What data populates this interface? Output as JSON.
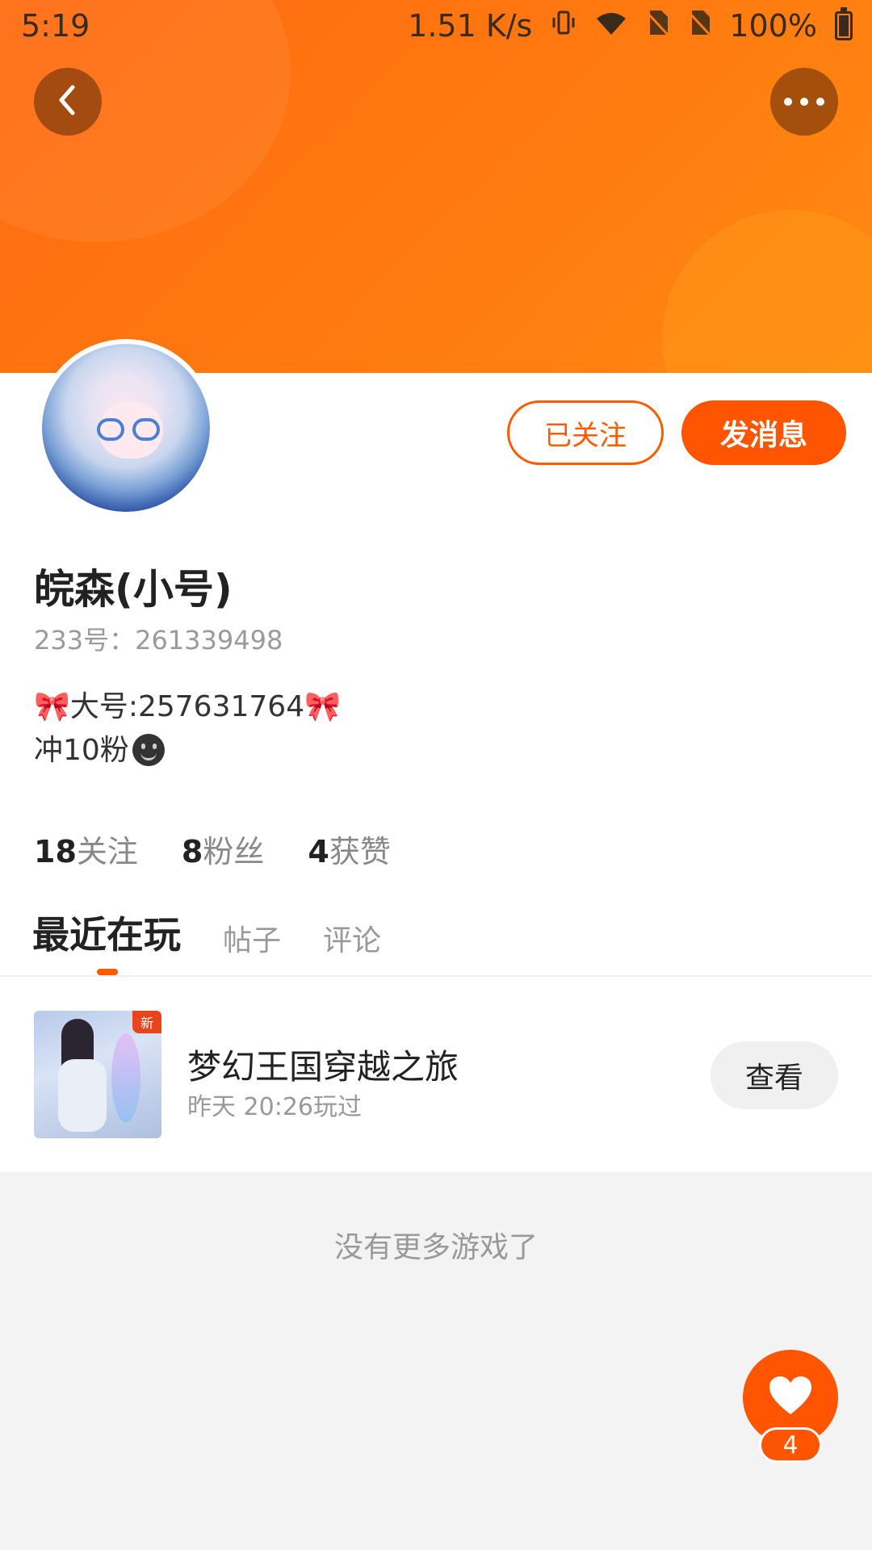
{
  "status_bar": {
    "time": "5:19",
    "net_speed": "1.51 K/s",
    "battery": "100%"
  },
  "header": {
    "back_icon": "chevron-left-icon",
    "more_icon": "more-dots-icon"
  },
  "profile": {
    "name": "皖森(小号)",
    "uid_text": "233号：261339498",
    "bio_line1": "🎀大号:257631764🎀",
    "bio_line2": "冲10粉",
    "follow_label": "已关注",
    "message_label": "发消息"
  },
  "stats": [
    {
      "num": "18",
      "label": "关注"
    },
    {
      "num": "8",
      "label": "粉丝"
    },
    {
      "num": "4",
      "label": "获赞"
    }
  ],
  "tabs": [
    {
      "label": "最近在玩",
      "active": true
    },
    {
      "label": "帖子",
      "active": false
    },
    {
      "label": "评论",
      "active": false
    }
  ],
  "games": [
    {
      "name": "梦幻王国穿越之旅",
      "time": "昨天 20:26玩过",
      "badge": "新",
      "action": "查看"
    }
  ],
  "footer_text": "没有更多游戏了",
  "like_fab": {
    "count": "4",
    "icon": "heart-icon"
  },
  "colors": {
    "accent": "#ff5400",
    "header_orange": "#ff7410"
  }
}
